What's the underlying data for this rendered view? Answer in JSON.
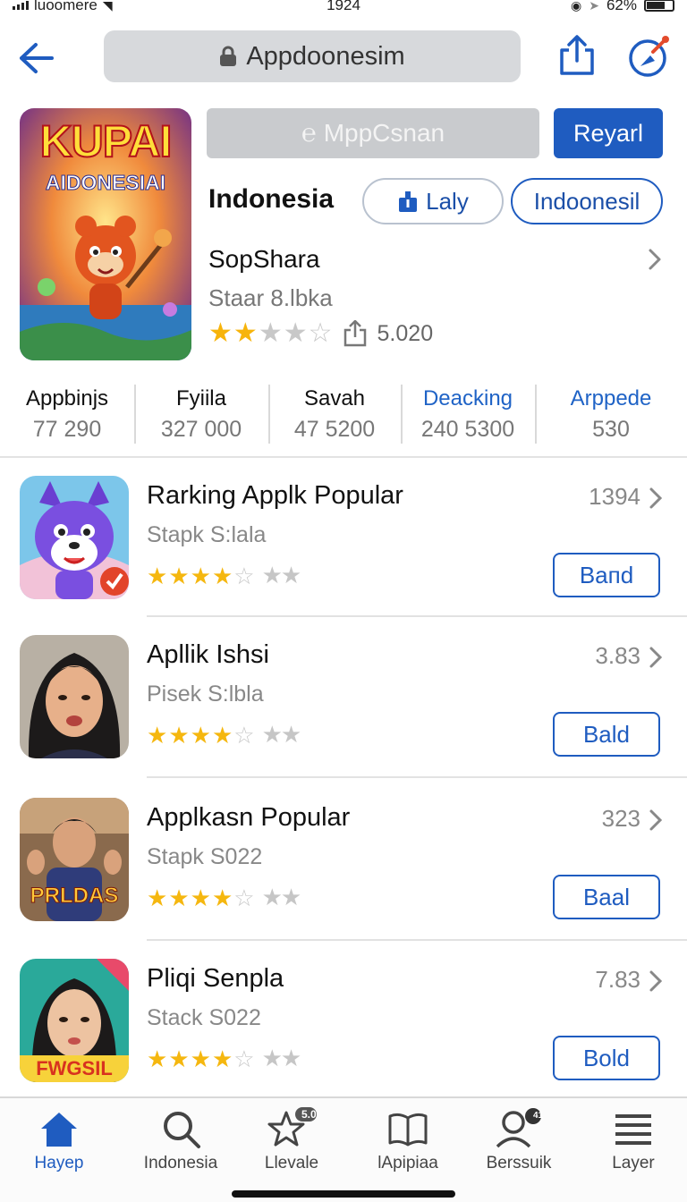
{
  "status_bar": {
    "carrier": "luoomere",
    "time": "1924",
    "battery": "62%"
  },
  "nav": {
    "url": "Appdoonesim"
  },
  "hero": {
    "art_title": "KUPAI",
    "art_subtitle": "AIDONESIAI",
    "search_placeholder": "MppCsnan",
    "primary_button": "Reyarl",
    "title": "Indonesia",
    "pill_like": "Laly",
    "pill_region": "Indoonesil",
    "developer": "SopShara",
    "subline": "Staar 8.lbka",
    "rating_count": "5.020",
    "rating_filled": 2
  },
  "stats": [
    {
      "label": "Appbinjs",
      "value": "77 290"
    },
    {
      "label": "Fyiila",
      "value": "327 000"
    },
    {
      "label": "Savah",
      "value": "47 5200"
    },
    {
      "label": "Deacking",
      "value": "240 5300"
    },
    {
      "label": "Arppede",
      "value": "530"
    }
  ],
  "apps": [
    {
      "title": "Rarking Applk Popular",
      "subtitle": "Stapk S:lala",
      "count": "1394",
      "button": "Baпd",
      "rating": 4
    },
    {
      "title": "Apllik Ishsi",
      "subtitle": "Pisek S:lbla",
      "count": "3.83",
      "button": "Bald",
      "rating": 4
    },
    {
      "title": "Applkasn Popular",
      "subtitle": "Stapk S022",
      "count": "323",
      "button": "Baal",
      "rating": 4,
      "icon_text": "PRLDAS"
    },
    {
      "title": "Pliqi Senpla",
      "subtitle": "Stack S022",
      "count": "7.83",
      "button": "Bold",
      "rating": 4,
      "icon_text": "FWGSIL"
    }
  ],
  "tabs": [
    {
      "label": "Hayep",
      "icon": "home-icon",
      "active": true
    },
    {
      "label": "Indonesia",
      "icon": "search-icon",
      "active": false
    },
    {
      "label": "Llevale",
      "icon": "star-icon",
      "badge": "5.0",
      "active": false
    },
    {
      "label": "lApipiaa",
      "icon": "book-icon",
      "active": false
    },
    {
      "label": "Berssuik",
      "icon": "person-icon",
      "badge": "41",
      "active": false
    },
    {
      "label": "Layer",
      "icon": "menu-icon",
      "active": false
    }
  ],
  "colors": {
    "accent": "#1f5cc0",
    "star": "#f5b70f",
    "divider": "#e2e2e2"
  }
}
